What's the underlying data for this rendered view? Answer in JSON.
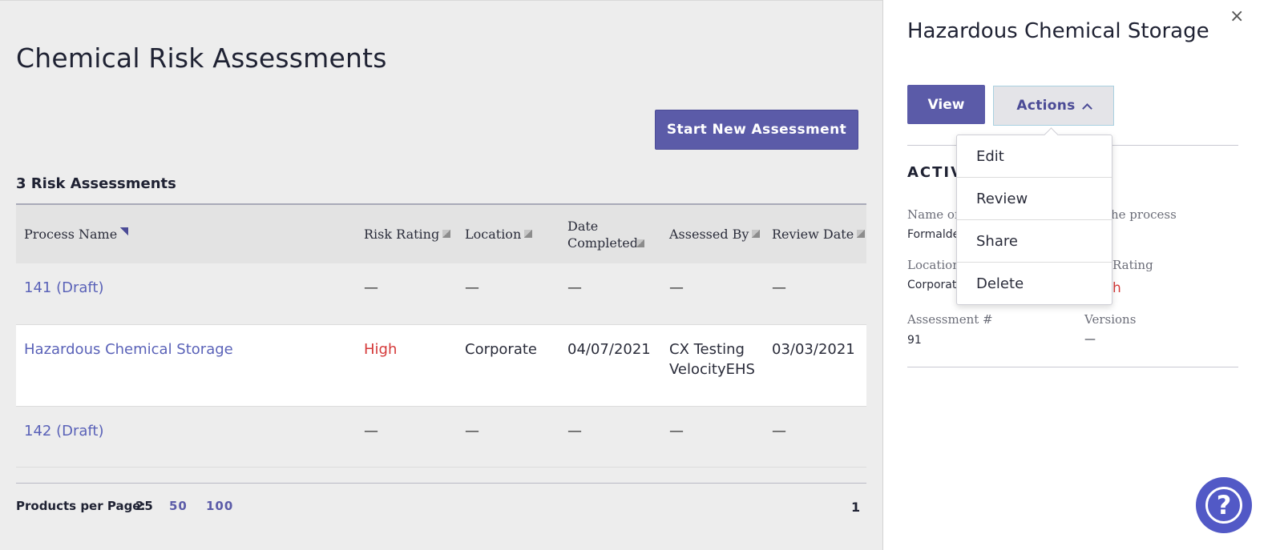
{
  "main": {
    "title": "Chemical Risk Assessments",
    "start_button": "Start New Assessment",
    "count_label": "3 Risk Assessments",
    "columns": [
      {
        "label": "Process Name",
        "sort": "active"
      },
      {
        "label": "Risk Rating",
        "sort": "neutral"
      },
      {
        "label": "Location",
        "sort": "neutral"
      },
      {
        "label": "Date Completed",
        "sort": "neutral"
      },
      {
        "label": "Assessed By",
        "sort": "neutral"
      },
      {
        "label": "Review Date",
        "sort": "neutral"
      }
    ],
    "rows": [
      {
        "name": "141 (Draft)",
        "risk": "—",
        "location": "—",
        "date_completed": "—",
        "assessed_by": "—",
        "review_date": "—"
      },
      {
        "name": "Hazardous Chemical Storage",
        "risk": "High",
        "location": "Corporate",
        "date_completed": "04/07/2021",
        "assessed_by": "CX Testing VelocityEHS",
        "review_date": "03/03/2021"
      },
      {
        "name": "142 (Draft)",
        "risk": "—",
        "location": "—",
        "date_completed": "—",
        "assessed_by": "—",
        "review_date": "—"
      }
    ],
    "pagination": {
      "per_page_label": "Products per Page:",
      "options": [
        "25",
        "50",
        "100"
      ],
      "current_option": "25",
      "current_page": "1"
    }
  },
  "panel": {
    "title": "Hazardous Chemical Storage",
    "close_glyph": "×",
    "view_button": "View",
    "actions_button": "Actions",
    "section_title": "ACTIV",
    "fields": {
      "name_label": "Name of",
      "name_label_right": "he process",
      "name_value": "Formalde",
      "location_label": "Location",
      "location_value": "Corporat",
      "rating_label": "Rating",
      "rating_value": "h",
      "assessment_label": "Assessment #",
      "assessment_value": "91",
      "versions_label": "Versions",
      "versions_value": "—"
    }
  },
  "actions_menu": [
    "Edit",
    "Review",
    "Share",
    "Delete"
  ],
  "help": {
    "glyph": "?"
  },
  "colors": {
    "brand": "#5b5ba8",
    "link": "#5a62b8",
    "danger": "#d53a3a",
    "help": "#5259c6"
  }
}
